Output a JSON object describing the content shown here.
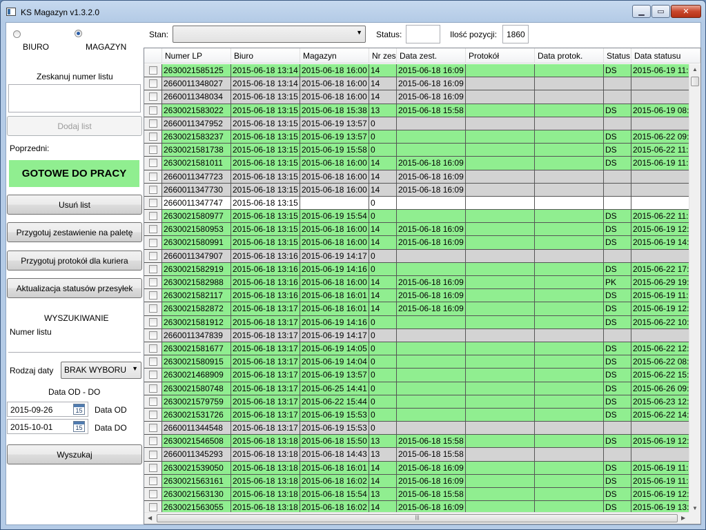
{
  "window": {
    "title": "KS Magazyn v1.3.2.0"
  },
  "mode": {
    "options": [
      "BIURO",
      "MAGAZYN"
    ],
    "selected": "MAGAZYN"
  },
  "scan": {
    "label": "Zeskanuj numer listu",
    "value": "",
    "add_button": "Dodaj list"
  },
  "previous": {
    "label": "Poprzedni:",
    "status": "GOTOWE DO PRACY",
    "status_color": "#90ee90"
  },
  "actions": {
    "remove": "Usuń list",
    "pallet": "Przygotuj zestawienie na paletę",
    "courier": "Przygotuj protokół dla kuriera",
    "update": "Aktualizacja statusów przesyłek"
  },
  "search": {
    "heading": "WYSZUKIWANIE",
    "number_label": "Numer listu",
    "number_value": "",
    "date_type_label": "Rodzaj daty",
    "date_type_value": "BRAK WYBORU",
    "range_label": "Data OD - DO",
    "date_from": "2015-09-26",
    "date_from_label": "Data OD",
    "date_to": "2015-10-01",
    "date_to_label": "Data DO",
    "calendar_day": "15",
    "search_button": "Wyszukaj"
  },
  "filters": {
    "stan_label": "Stan:",
    "stan_value": "",
    "status_label": "Status:",
    "status_value": "",
    "count_label": "Ilość pozycji:",
    "count_value": "1860"
  },
  "grid": {
    "columns": [
      "Numer LP",
      "Biuro",
      "Magazyn",
      "Nr zes",
      "Data zest.",
      "Protokół",
      "Data protok.",
      "Status",
      "Data statusu"
    ],
    "row_colors": {
      "green": "#90ee90",
      "gray": "#d3d3d3",
      "white": "#ffffff"
    },
    "rows": [
      {
        "c": "green",
        "v": [
          "2630021585125",
          "2015-06-18 13:14",
          "2015-06-18 16:00",
          "14",
          "2015-06-18 16:09",
          "",
          "",
          "DS",
          "2015-06-19 11:5"
        ]
      },
      {
        "c": "gray",
        "v": [
          "2660011348027",
          "2015-06-18 13:14",
          "2015-06-18 16:00",
          "14",
          "2015-06-18 16:09",
          "",
          "",
          "",
          ""
        ]
      },
      {
        "c": "gray",
        "v": [
          "2660011348034",
          "2015-06-18 13:15",
          "2015-06-18 16:00",
          "14",
          "2015-06-18 16:09",
          "",
          "",
          "",
          ""
        ]
      },
      {
        "c": "green",
        "v": [
          "2630021583022",
          "2015-06-18 13:15",
          "2015-06-18 15:38",
          "13",
          "2015-06-18 15:58",
          "",
          "",
          "DS",
          "2015-06-19 08:5"
        ]
      },
      {
        "c": "gray",
        "v": [
          "2660011347952",
          "2015-06-18 13:15",
          "2015-06-19 13:57",
          "0",
          "",
          "",
          "",
          "",
          ""
        ]
      },
      {
        "c": "green",
        "v": [
          "2630021583237",
          "2015-06-18 13:15",
          "2015-06-19 13:57",
          "0",
          "",
          "",
          "",
          "DS",
          "2015-06-22 09:4"
        ]
      },
      {
        "c": "green",
        "v": [
          "2630021581738",
          "2015-06-18 13:15",
          "2015-06-19 15:58",
          "0",
          "",
          "",
          "",
          "DS",
          "2015-06-22 11:1"
        ]
      },
      {
        "c": "green",
        "v": [
          "2630021581011",
          "2015-06-18 13:15",
          "2015-06-18 16:00",
          "14",
          "2015-06-18 16:09",
          "",
          "",
          "DS",
          "2015-06-19 11:2"
        ]
      },
      {
        "c": "gray",
        "v": [
          "2660011347723",
          "2015-06-18 13:15",
          "2015-06-18 16:00",
          "14",
          "2015-06-18 16:09",
          "",
          "",
          "",
          ""
        ]
      },
      {
        "c": "gray",
        "v": [
          "2660011347730",
          "2015-06-18 13:15",
          "2015-06-18 16:00",
          "14",
          "2015-06-18 16:09",
          "",
          "",
          "",
          ""
        ]
      },
      {
        "c": "white",
        "v": [
          "2660011347747",
          "2015-06-18 13:15",
          "",
          "0",
          "",
          "",
          "",
          "",
          ""
        ]
      },
      {
        "c": "green",
        "v": [
          "2630021580977",
          "2015-06-18 13:15",
          "2015-06-19 15:54",
          "0",
          "",
          "",
          "",
          "DS",
          "2015-06-22 11:0"
        ]
      },
      {
        "c": "green",
        "v": [
          "2630021580953",
          "2015-06-18 13:15",
          "2015-06-18 16:00",
          "14",
          "2015-06-18 16:09",
          "",
          "",
          "DS",
          "2015-06-19 12:3"
        ]
      },
      {
        "c": "green",
        "v": [
          "2630021580991",
          "2015-06-18 13:15",
          "2015-06-18 16:00",
          "14",
          "2015-06-18 16:09",
          "",
          "",
          "DS",
          "2015-06-19 14:0"
        ]
      },
      {
        "c": "gray",
        "v": [
          "2660011347907",
          "2015-06-18 13:16",
          "2015-06-19 14:17",
          "0",
          "",
          "",
          "",
          "",
          ""
        ]
      },
      {
        "c": "green",
        "v": [
          "2630021582919",
          "2015-06-18 13:16",
          "2015-06-19 14:16",
          "0",
          "",
          "",
          "",
          "DS",
          "2015-06-22 17:0"
        ]
      },
      {
        "c": "green",
        "v": [
          "2630021582988",
          "2015-06-18 13:16",
          "2015-06-18 16:00",
          "14",
          "2015-06-18 16:09",
          "",
          "",
          "PK",
          "2015-06-29 19:0"
        ]
      },
      {
        "c": "green",
        "v": [
          "2630021582117",
          "2015-06-18 13:16",
          "2015-06-18 16:01",
          "14",
          "2015-06-18 16:09",
          "",
          "",
          "DS",
          "2015-06-19 11:0"
        ]
      },
      {
        "c": "green",
        "v": [
          "2630021582872",
          "2015-06-18 13:17",
          "2015-06-18 16:01",
          "14",
          "2015-06-18 16:09",
          "",
          "",
          "DS",
          "2015-06-19 12:3"
        ]
      },
      {
        "c": "green",
        "v": [
          "2630021581912",
          "2015-06-18 13:17",
          "2015-06-19 14:16",
          "0",
          "",
          "",
          "",
          "DS",
          "2015-06-22 10:2"
        ]
      },
      {
        "c": "gray",
        "v": [
          "2660011347839",
          "2015-06-18 13:17",
          "2015-06-19 14:17",
          "0",
          "",
          "",
          "",
          "",
          ""
        ]
      },
      {
        "c": "green",
        "v": [
          "2630021581677",
          "2015-06-18 13:17",
          "2015-06-19 14:05",
          "0",
          "",
          "",
          "",
          "DS",
          "2015-06-22 12:0"
        ]
      },
      {
        "c": "green",
        "v": [
          "2630021580915",
          "2015-06-18 13:17",
          "2015-06-19 14:04",
          "0",
          "",
          "",
          "",
          "DS",
          "2015-06-22 08:4"
        ]
      },
      {
        "c": "green",
        "v": [
          "2630021468909",
          "2015-06-18 13:17",
          "2015-06-19 13:57",
          "0",
          "",
          "",
          "",
          "DS",
          "2015-06-22 15:3"
        ]
      },
      {
        "c": "green",
        "v": [
          "2630021580748",
          "2015-06-18 13:17",
          "2015-06-25 14:41",
          "0",
          "",
          "",
          "",
          "DS",
          "2015-06-26 09:3"
        ]
      },
      {
        "c": "green",
        "v": [
          "2630021579759",
          "2015-06-18 13:17",
          "2015-06-22 15:44",
          "0",
          "",
          "",
          "",
          "DS",
          "2015-06-23 12:4"
        ]
      },
      {
        "c": "green",
        "v": [
          "2630021531726",
          "2015-06-18 13:17",
          "2015-06-19 15:53",
          "0",
          "",
          "",
          "",
          "DS",
          "2015-06-22 14:3"
        ]
      },
      {
        "c": "gray",
        "v": [
          "2660011344548",
          "2015-06-18 13:17",
          "2015-06-19 15:53",
          "0",
          "",
          "",
          "",
          "",
          ""
        ]
      },
      {
        "c": "green",
        "v": [
          "2630021546508",
          "2015-06-18 13:18",
          "2015-06-18 15:50",
          "13",
          "2015-06-18 15:58",
          "",
          "",
          "DS",
          "2015-06-19 12:0"
        ]
      },
      {
        "c": "gray",
        "v": [
          "2660011345293",
          "2015-06-18 13:18",
          "2015-06-18 14:43",
          "13",
          "2015-06-18 15:58",
          "",
          "",
          "",
          ""
        ]
      },
      {
        "c": "green",
        "v": [
          "2630021539050",
          "2015-06-18 13:18",
          "2015-06-18 16:01",
          "14",
          "2015-06-18 16:09",
          "",
          "",
          "DS",
          "2015-06-19 11:3"
        ]
      },
      {
        "c": "green",
        "v": [
          "2630021563161",
          "2015-06-18 13:18",
          "2015-06-18 16:02",
          "14",
          "2015-06-18 16:09",
          "",
          "",
          "DS",
          "2015-06-19 11:4"
        ]
      },
      {
        "c": "green",
        "v": [
          "2630021563130",
          "2015-06-18 13:18",
          "2015-06-18 15:54",
          "13",
          "2015-06-18 15:58",
          "",
          "",
          "DS",
          "2015-06-19 12:3"
        ]
      },
      {
        "c": "green",
        "v": [
          "2630021563055",
          "2015-06-18 13:18",
          "2015-06-18 16:02",
          "14",
          "2015-06-18 16:09",
          "",
          "",
          "DS",
          "2015-06-19 13:1"
        ]
      }
    ]
  },
  "icons": {
    "minimize": "minimize-icon",
    "maximize": "maximize-icon",
    "close": "close-icon",
    "calendar": "calendar-icon",
    "dropdown": "chevron-down-icon"
  }
}
